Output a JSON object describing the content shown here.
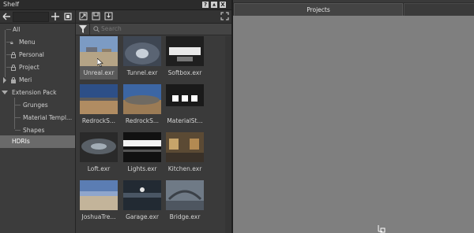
{
  "window": {
    "title": "Shelf"
  },
  "title_buttons": {
    "help": "?",
    "pin": "▲",
    "close": "X"
  },
  "tree": {
    "items": [
      {
        "label": "All"
      },
      {
        "label": "Menu"
      },
      {
        "label": "Personal"
      },
      {
        "label": "Project"
      },
      {
        "label": "Meri"
      },
      {
        "label": "Extension Pack"
      },
      {
        "label": "Grunges"
      },
      {
        "label": "Material Templ..."
      },
      {
        "label": "Shapes"
      },
      {
        "label": "HDRIs"
      }
    ],
    "selected": "HDRIs"
  },
  "search": {
    "placeholder": "Search"
  },
  "thumbnails": [
    {
      "label": "Unreal.exr"
    },
    {
      "label": "Tunnel.exr"
    },
    {
      "label": "Softbox.exr"
    },
    {
      "label": "RedrockS..."
    },
    {
      "label": "RedrockS..."
    },
    {
      "label": "MaterialSt..."
    },
    {
      "label": "Loft.exr"
    },
    {
      "label": "Lights.exr"
    },
    {
      "label": "Kitchen.exr"
    },
    {
      "label": "JoshuaTre..."
    },
    {
      "label": "Garage.exr"
    },
    {
      "label": "Bridge.exr"
    }
  ],
  "projects": {
    "tab_label": "Projects"
  }
}
